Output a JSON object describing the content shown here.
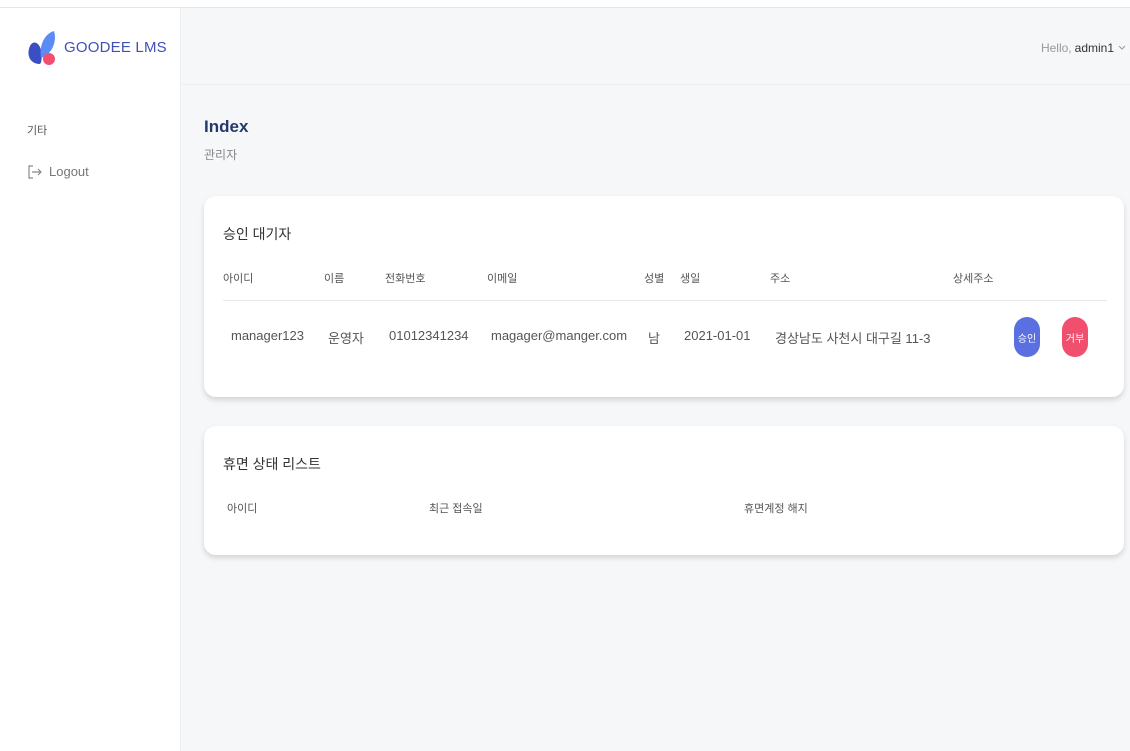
{
  "brand": {
    "name": "GOODEE LMS"
  },
  "sidebar": {
    "section_label": "기타",
    "logout_label": "Logout"
  },
  "header": {
    "greeting": "Hello,",
    "username": "admin1"
  },
  "page": {
    "title": "Index",
    "subtitle": "관리자"
  },
  "pending": {
    "title": "승인 대기자",
    "columns": [
      "아이디",
      "이름",
      "전화번호",
      "이메일",
      "성별",
      "생일",
      "주소",
      "상세주소"
    ],
    "rows": [
      {
        "id": "manager123",
        "name": "운영자",
        "phone": "01012341234",
        "email": "magager@manger.com",
        "gender": "남",
        "birthday": "2021-01-01",
        "address": "경상남도 사천시 대구길 11-3",
        "address_detail": "",
        "approve_label": "승인",
        "reject_label": "거부"
      }
    ]
  },
  "dormant": {
    "title": "휴면 상태 리스트",
    "columns": [
      "아이디",
      "최근 접속일",
      "휴면계정 해지"
    ]
  },
  "colors": {
    "approve": "#5a6fe0",
    "reject": "#f0506e",
    "brand_text": "#3f51b5"
  }
}
